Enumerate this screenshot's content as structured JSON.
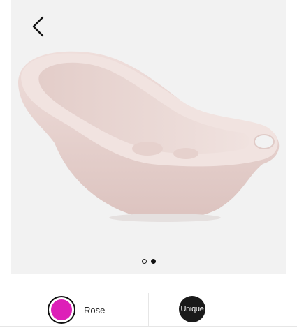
{
  "gallery": {
    "product_image_icon": "baby-bathtub",
    "product_color": "#ecd9d4",
    "slide_count": 2,
    "active_slide": 2
  },
  "options": {
    "colors": [
      {
        "label": "Rose",
        "swatch_color": "#dd1fb8",
        "selected": true
      },
      {
        "label": "Unique",
        "swatch_color": "#1a1a1a",
        "selected": false
      }
    ]
  }
}
